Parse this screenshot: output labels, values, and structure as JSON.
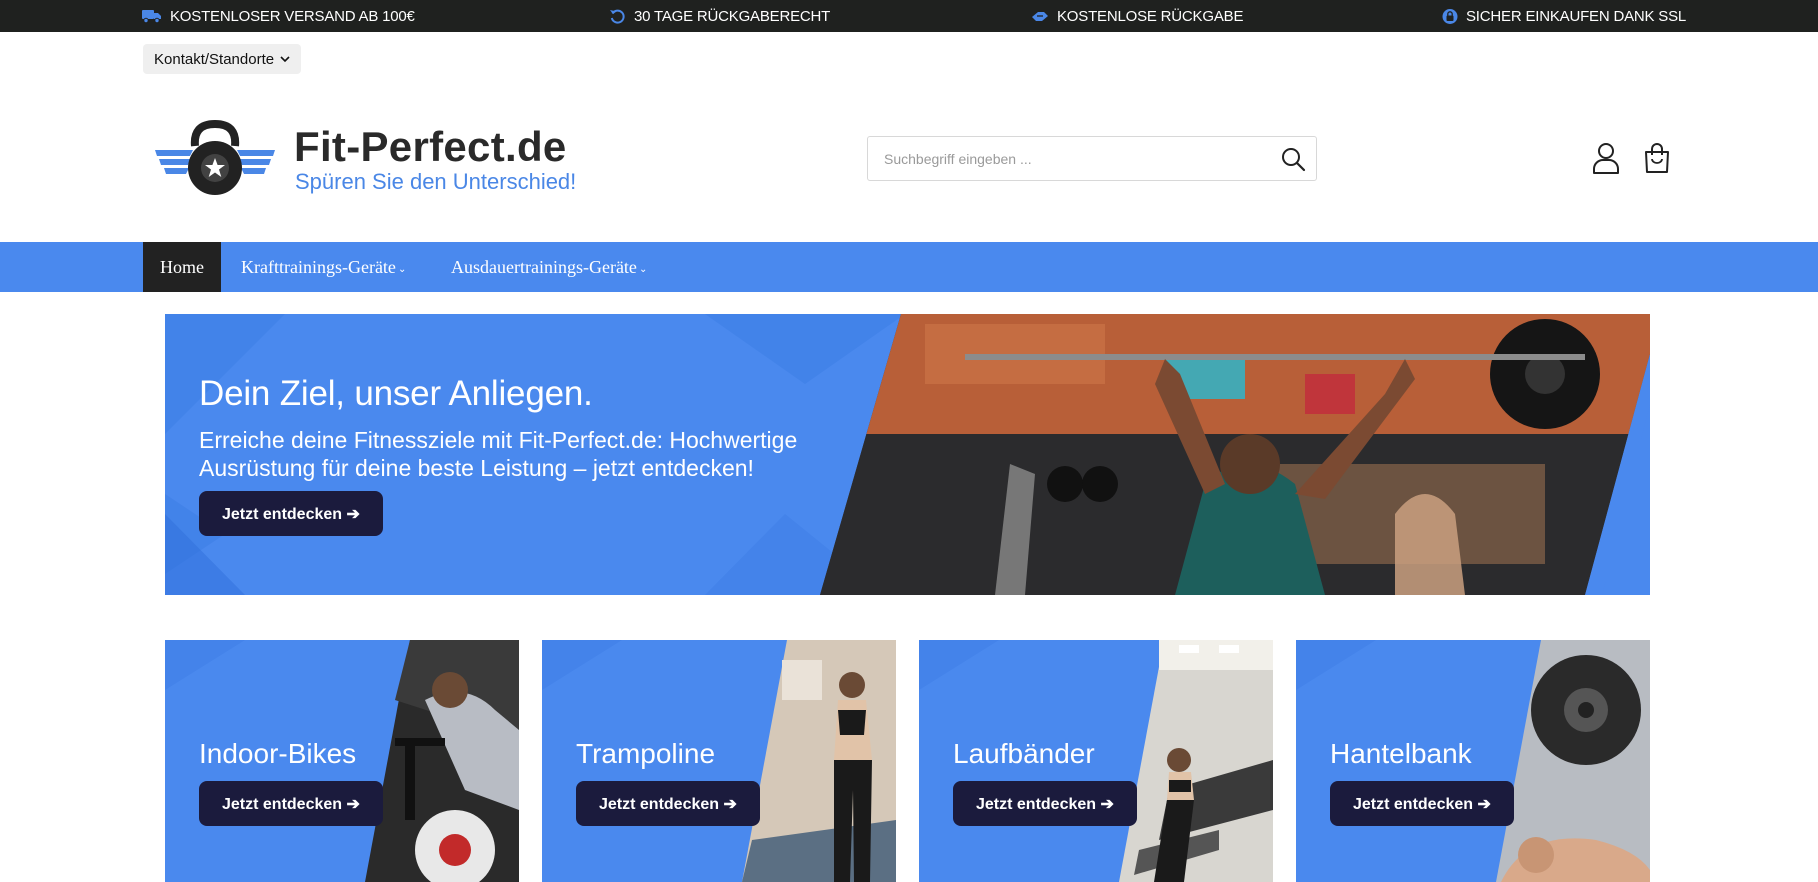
{
  "topbar": {
    "items": [
      {
        "icon": "truck-icon",
        "label": "KOSTENLOSER VERSAND AB 100€"
      },
      {
        "icon": "return-arrow-icon",
        "label": "30 TAGE RÜCKGABERECHT"
      },
      {
        "icon": "box-return-icon",
        "label": "KOSTENLOSE RÜCKGABE"
      },
      {
        "icon": "lock-icon",
        "label": "SICHER EINKAUFEN DANK SSL"
      }
    ]
  },
  "header": {
    "contact_label": "Kontakt/Standorte",
    "brand_name": "Fit-Perfect.de",
    "slogan": "Spüren Sie den Unterschied!",
    "search_placeholder": "Suchbegriff eingeben ..."
  },
  "nav": {
    "items": [
      {
        "label": "Home",
        "active": true
      },
      {
        "label": "Krafttrainings-Geräte",
        "active": false
      },
      {
        "label": "Ausdauertrainings-Geräte",
        "active": false
      }
    ]
  },
  "hero": {
    "title": "Dein Ziel, unser Anliegen.",
    "text": "Erreiche deine Fitnessziele mit Fit-Perfect.de: Hochwertige Ausrüstung für deine beste Leistung – jetzt entdecken!",
    "button_label": "Jetzt entdecken ➔"
  },
  "categories": [
    {
      "title": "Indoor-Bikes",
      "button_label": "Jetzt entdecken ➔"
    },
    {
      "title": "Trampoline",
      "button_label": "Jetzt entdecken ➔"
    },
    {
      "title": "Laufbänder",
      "button_label": "Jetzt entdecken ➔"
    },
    {
      "title": "Hantelbank",
      "button_label": "Jetzt entdecken ➔"
    }
  ],
  "colors": {
    "topbar_bg": "#1f211f",
    "accent_blue": "#4a89ee",
    "icon_blue": "#4a87e6",
    "button_dark": "#1b1b3d"
  }
}
